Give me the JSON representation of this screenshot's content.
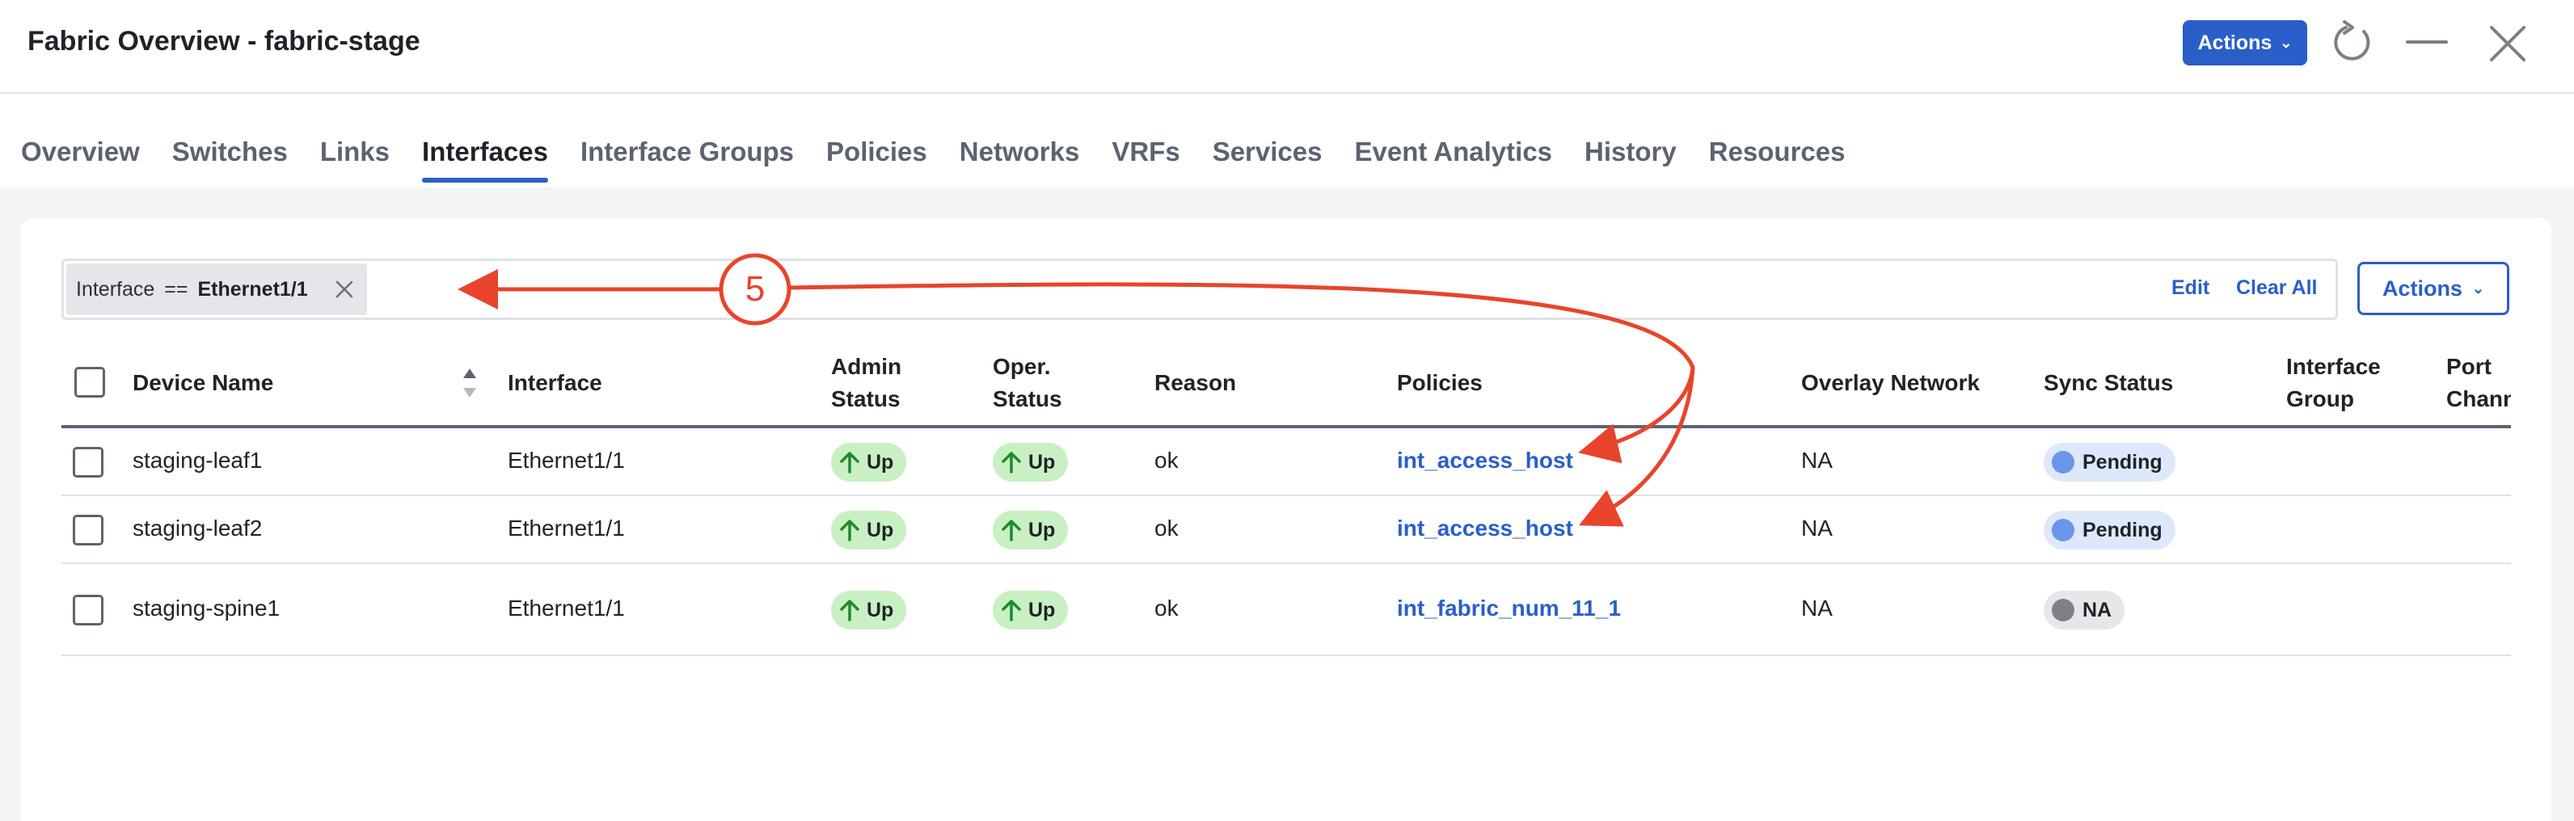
{
  "window": {
    "title": "Fabric Overview - fabric-stage",
    "actions_label": "Actions"
  },
  "tabs": [
    "Overview",
    "Switches",
    "Links",
    "Interfaces",
    "Interface Groups",
    "Policies",
    "Networks",
    "VRFs",
    "Services",
    "Event Analytics",
    "History",
    "Resources"
  ],
  "active_tab": "Interfaces",
  "filter": {
    "key": "Interface",
    "operator": "==",
    "value": "Ethernet1/1",
    "edit_label": "Edit",
    "clear_label": "Clear All"
  },
  "table": {
    "actions_label": "Actions",
    "columns": {
      "device_name": "Device Name",
      "interface": "Interface",
      "admin_status_1": "Admin",
      "admin_status_2": "Status",
      "oper_status_1": "Oper.",
      "oper_status_2": "Status",
      "reason": "Reason",
      "policies": "Policies",
      "overlay_network": "Overlay Network",
      "sync_status": "Sync Status",
      "interface_group_1": "Interface",
      "interface_group_2": "Group",
      "port_channel_1": "Port",
      "port_channel_2": "Channel"
    },
    "rows": [
      {
        "device": "staging-leaf1",
        "interface": "Ethernet1/1",
        "admin": "Up",
        "oper": "Up",
        "reason": "ok",
        "policy": "int_access_host",
        "overlay": "NA",
        "sync": "Pending"
      },
      {
        "device": "staging-leaf2",
        "interface": "Ethernet1/1",
        "admin": "Up",
        "oper": "Up",
        "reason": "ok",
        "policy": "int_access_host",
        "overlay": "NA",
        "sync": "Pending"
      },
      {
        "device": "staging-spine1",
        "interface": "Ethernet1/1",
        "admin": "Up",
        "oper": "Up",
        "reason": "ok",
        "policy": "int_fabric_num_11_1",
        "overlay": "NA",
        "sync": "NA"
      }
    ]
  },
  "annotation": {
    "step_number": "5"
  },
  "colors": {
    "accent": "#2a5fc9",
    "status_up_bg": "#c8f0c2",
    "status_up_icon": "#1e8a2e",
    "pending_bg": "#dde8fb",
    "pending_dot": "#6b95ea",
    "na_bg": "#e6e7e9",
    "na_dot": "#7d8187",
    "annotation": "#e8442c"
  }
}
